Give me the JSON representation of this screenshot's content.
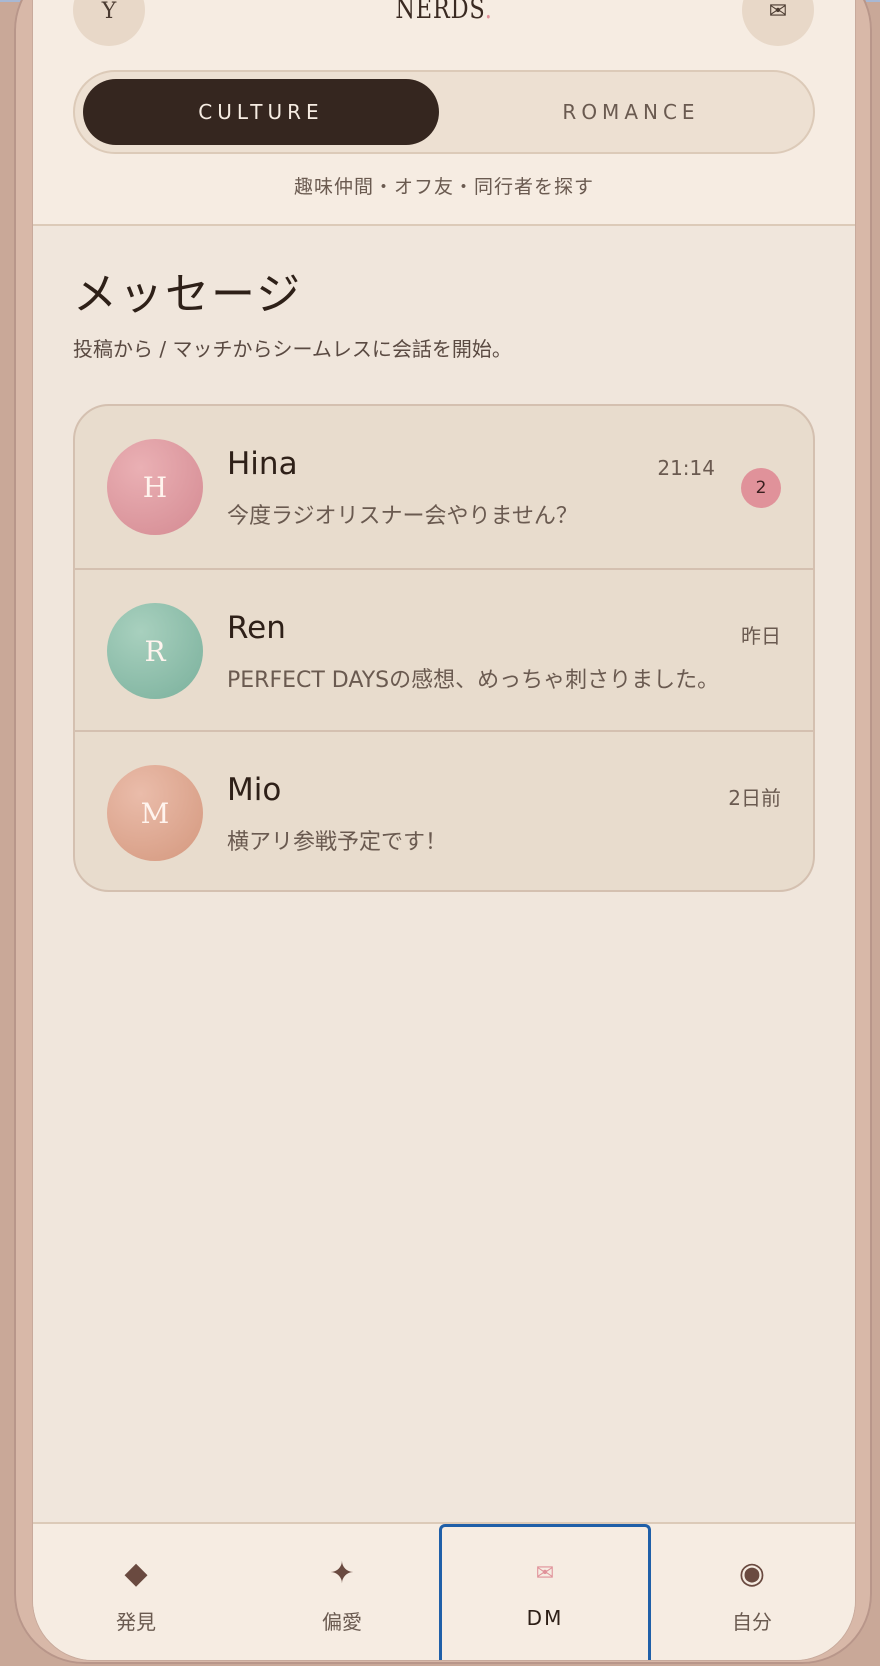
{
  "header": {
    "left_button_label": "Y",
    "logo_text": "NERDS",
    "logo_dot": ".",
    "right_button_icon": "mail-icon",
    "right_button_glyph": "✉",
    "modes": [
      {
        "label": "CULTURE",
        "active": true
      },
      {
        "label": "ROMANCE",
        "active": false
      }
    ],
    "tagline": "趣味仲間・オフ友・同行者を探す"
  },
  "main": {
    "title": "メッセージ",
    "subtitle": "投稿から / マッチからシームレスに会話を開始。",
    "conversations": [
      {
        "initial": "H",
        "name": "Hina",
        "time": "21:14",
        "preview": "今度ラジオリスナー会やりません？",
        "unread": "2",
        "avatar_color": "#dc9aa0"
      },
      {
        "initial": "R",
        "name": "Ren",
        "time": "昨日",
        "preview": "PERFECT DAYSの感想、めっちゃ刺さりました。",
        "unread": null,
        "avatar_color": "#8ec0ac"
      },
      {
        "initial": "M",
        "name": "Mio",
        "time": "2日前",
        "preview": "横アリ参戦予定です！",
        "unread": null,
        "avatar_color": "#e0aa94"
      }
    ]
  },
  "bottom_nav": {
    "items": [
      {
        "label": "発見",
        "icon": "diamond-icon",
        "glyph": "◆",
        "active": false
      },
      {
        "label": "偏愛",
        "icon": "sparkle-icon",
        "glyph": "✦",
        "active": false
      },
      {
        "label": "DM",
        "icon": "mail-icon",
        "glyph": "✉",
        "active": true
      },
      {
        "label": "自分",
        "icon": "profile-icon",
        "glyph": "◉",
        "active": false
      }
    ]
  },
  "colors": {
    "accent": "#e0929a",
    "dark": "#35261f",
    "background": "#f0e6dc",
    "focus_outline": "#1f5fa8"
  }
}
